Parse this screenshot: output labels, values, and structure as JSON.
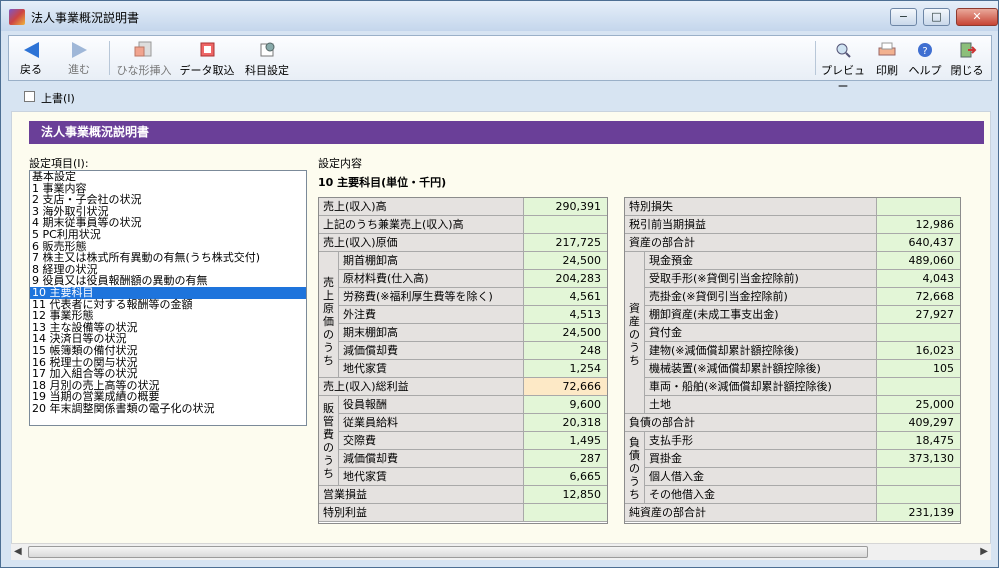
{
  "window": {
    "title": "法人事業概況説明書",
    "min": "−",
    "max": "□",
    "close": "✕"
  },
  "toolbar": {
    "back": "戻る",
    "forward": "進む",
    "template": "ひな形挿入",
    "import": "データ取込",
    "subjects": "科目設定",
    "preview": "プレビュー",
    "print": "印刷",
    "help": "ヘルプ",
    "close": "閉じる"
  },
  "overwrite": "上書(I)",
  "header": "法人事業概況説明書",
  "left": {
    "title": "設定項目(I):",
    "items": [
      "基本設定",
      "1 事業内容",
      "2 支店・子会社の状況",
      "3 海外取引状況",
      "4 期末従事員等の状況",
      "5 PC利用状況",
      "6 販売形態",
      "7 株主又は株式所有異動の有無(うち株式交付)",
      "8 経理の状況",
      "9 役員又は役員報酬額の異動の有無",
      "10 主要科目",
      "11 代表者に対する報酬等の金額",
      "12 事業形態",
      "13 主な設備等の状況",
      "14 決済日等の状況",
      "15 帳簿類の備付状況",
      "16 税理士の関与状況",
      "17 加入組合等の状況",
      "18 月別の売上高等の状況",
      "19 当期の営業成績の概要",
      "20 年末調整関係書類の電子化の状況"
    ],
    "selected": 10
  },
  "right": {
    "title": "設定内容",
    "section": "10 主要科目(単位・千円)"
  },
  "leftTable": {
    "rows": [
      {
        "label": "売上(収入)高",
        "value": "290,391"
      },
      {
        "label": "上記のうち兼業売上(収入)高",
        "value": ""
      },
      {
        "label": "売上(収入)原価",
        "value": "217,725"
      },
      {
        "label": "期首棚卸高",
        "value": "24,500"
      },
      {
        "label": "原材料費(仕入高)",
        "value": "204,283"
      },
      {
        "label": "労務費(※福利厚生費等を除く)",
        "value": "4,561"
      },
      {
        "label": "外注費",
        "value": "4,513"
      },
      {
        "label": "期末棚卸高",
        "value": "24,500"
      },
      {
        "label": "減価償却費",
        "value": "248"
      },
      {
        "label": "地代家賃",
        "value": "1,254"
      },
      {
        "label": "売上(収入)総利益",
        "value": "72,666"
      },
      {
        "label": "役員報酬",
        "value": "9,600"
      },
      {
        "label": "従業員給料",
        "value": "20,318"
      },
      {
        "label": "交際費",
        "value": "1,495"
      },
      {
        "label": "減価償却費",
        "value": "287"
      },
      {
        "label": "地代家賃",
        "value": "6,665"
      },
      {
        "label": "営業損益",
        "value": "12,850"
      },
      {
        "label": "特別利益",
        "value": ""
      }
    ],
    "group1": "売上原価のうち",
    "group2": "販管費のうち"
  },
  "rightTable": {
    "rows": [
      {
        "label": "特別損失",
        "value": ""
      },
      {
        "label": "税引前当期損益",
        "value": "12,986"
      },
      {
        "label": "資産の部合計",
        "value": "640,437"
      },
      {
        "label": "現金預金",
        "value": "489,060"
      },
      {
        "label": "受取手形(※貸倒引当金控除前)",
        "value": "4,043"
      },
      {
        "label": "売掛金(※貸倒引当金控除前)",
        "value": "72,668"
      },
      {
        "label": "棚卸資産(未成工事支出金)",
        "value": "27,927"
      },
      {
        "label": "貸付金",
        "value": ""
      },
      {
        "label": "建物(※減価償却累計額控除後)",
        "value": "16,023"
      },
      {
        "label": "機械装置(※減価償却累計額控除後)",
        "value": "105"
      },
      {
        "label": "車両・船舶(※減価償却累計額控除後)",
        "value": ""
      },
      {
        "label": "土地",
        "value": "25,000"
      },
      {
        "label": "負債の部合計",
        "value": "409,297"
      },
      {
        "label": "支払手形",
        "value": "18,475"
      },
      {
        "label": "買掛金",
        "value": "373,130"
      },
      {
        "label": "個人借入金",
        "value": ""
      },
      {
        "label": "その他借入金",
        "value": ""
      },
      {
        "label": "純資産の部合計",
        "value": "231,139"
      }
    ],
    "group1": "資産のうち",
    "group2": "負債のうち"
  }
}
